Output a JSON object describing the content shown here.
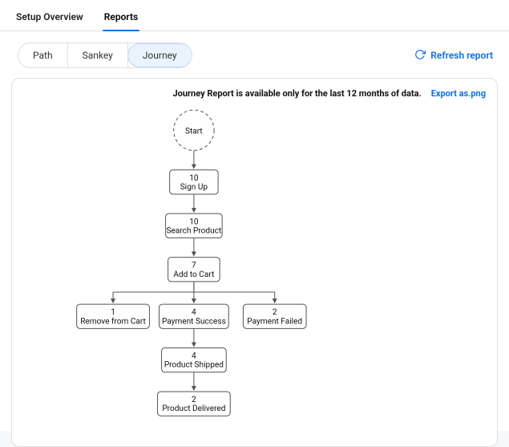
{
  "colors": {
    "accent": "#0d6ee6",
    "border": "#e0e0e0"
  },
  "top_tabs": {
    "items": [
      {
        "label": "Setup Overview"
      },
      {
        "label": "Reports"
      }
    ],
    "active_index": 1
  },
  "sub_tabs": {
    "items": [
      {
        "label": "Path"
      },
      {
        "label": "Sankey"
      },
      {
        "label": "Journey"
      }
    ],
    "active_index": 2
  },
  "actions": {
    "refresh_label": "Refresh report",
    "export_label": "Export as.png"
  },
  "panel": {
    "availability_note": "Journey Report is available only for the last 12 months of data."
  },
  "chart_data": {
    "type": "diagram",
    "nodes": [
      {
        "id": "start",
        "label": "Start",
        "count": null,
        "kind": "start"
      },
      {
        "id": "signup",
        "label": "Sign Up",
        "count": 10,
        "kind": "step"
      },
      {
        "id": "search",
        "label": "Search Product",
        "count": 10,
        "kind": "step"
      },
      {
        "id": "cart",
        "label": "Add to Cart",
        "count": 7,
        "kind": "step"
      },
      {
        "id": "remove",
        "label": "Remove from Cart",
        "count": 1,
        "kind": "step"
      },
      {
        "id": "paysuccess",
        "label": "Payment Success",
        "count": 4,
        "kind": "step"
      },
      {
        "id": "payfailed",
        "label": "Payment Failed",
        "count": 2,
        "kind": "step"
      },
      {
        "id": "shipped",
        "label": "Product Shipped",
        "count": 4,
        "kind": "step"
      },
      {
        "id": "delivered",
        "label": "Product Delivered",
        "count": 2,
        "kind": "step"
      }
    ],
    "edges": [
      {
        "from": "start",
        "to": "signup"
      },
      {
        "from": "signup",
        "to": "search"
      },
      {
        "from": "search",
        "to": "cart"
      },
      {
        "from": "cart",
        "to": "remove"
      },
      {
        "from": "cart",
        "to": "paysuccess"
      },
      {
        "from": "cart",
        "to": "payfailed"
      },
      {
        "from": "paysuccess",
        "to": "shipped"
      },
      {
        "from": "shipped",
        "to": "delivered"
      }
    ]
  }
}
